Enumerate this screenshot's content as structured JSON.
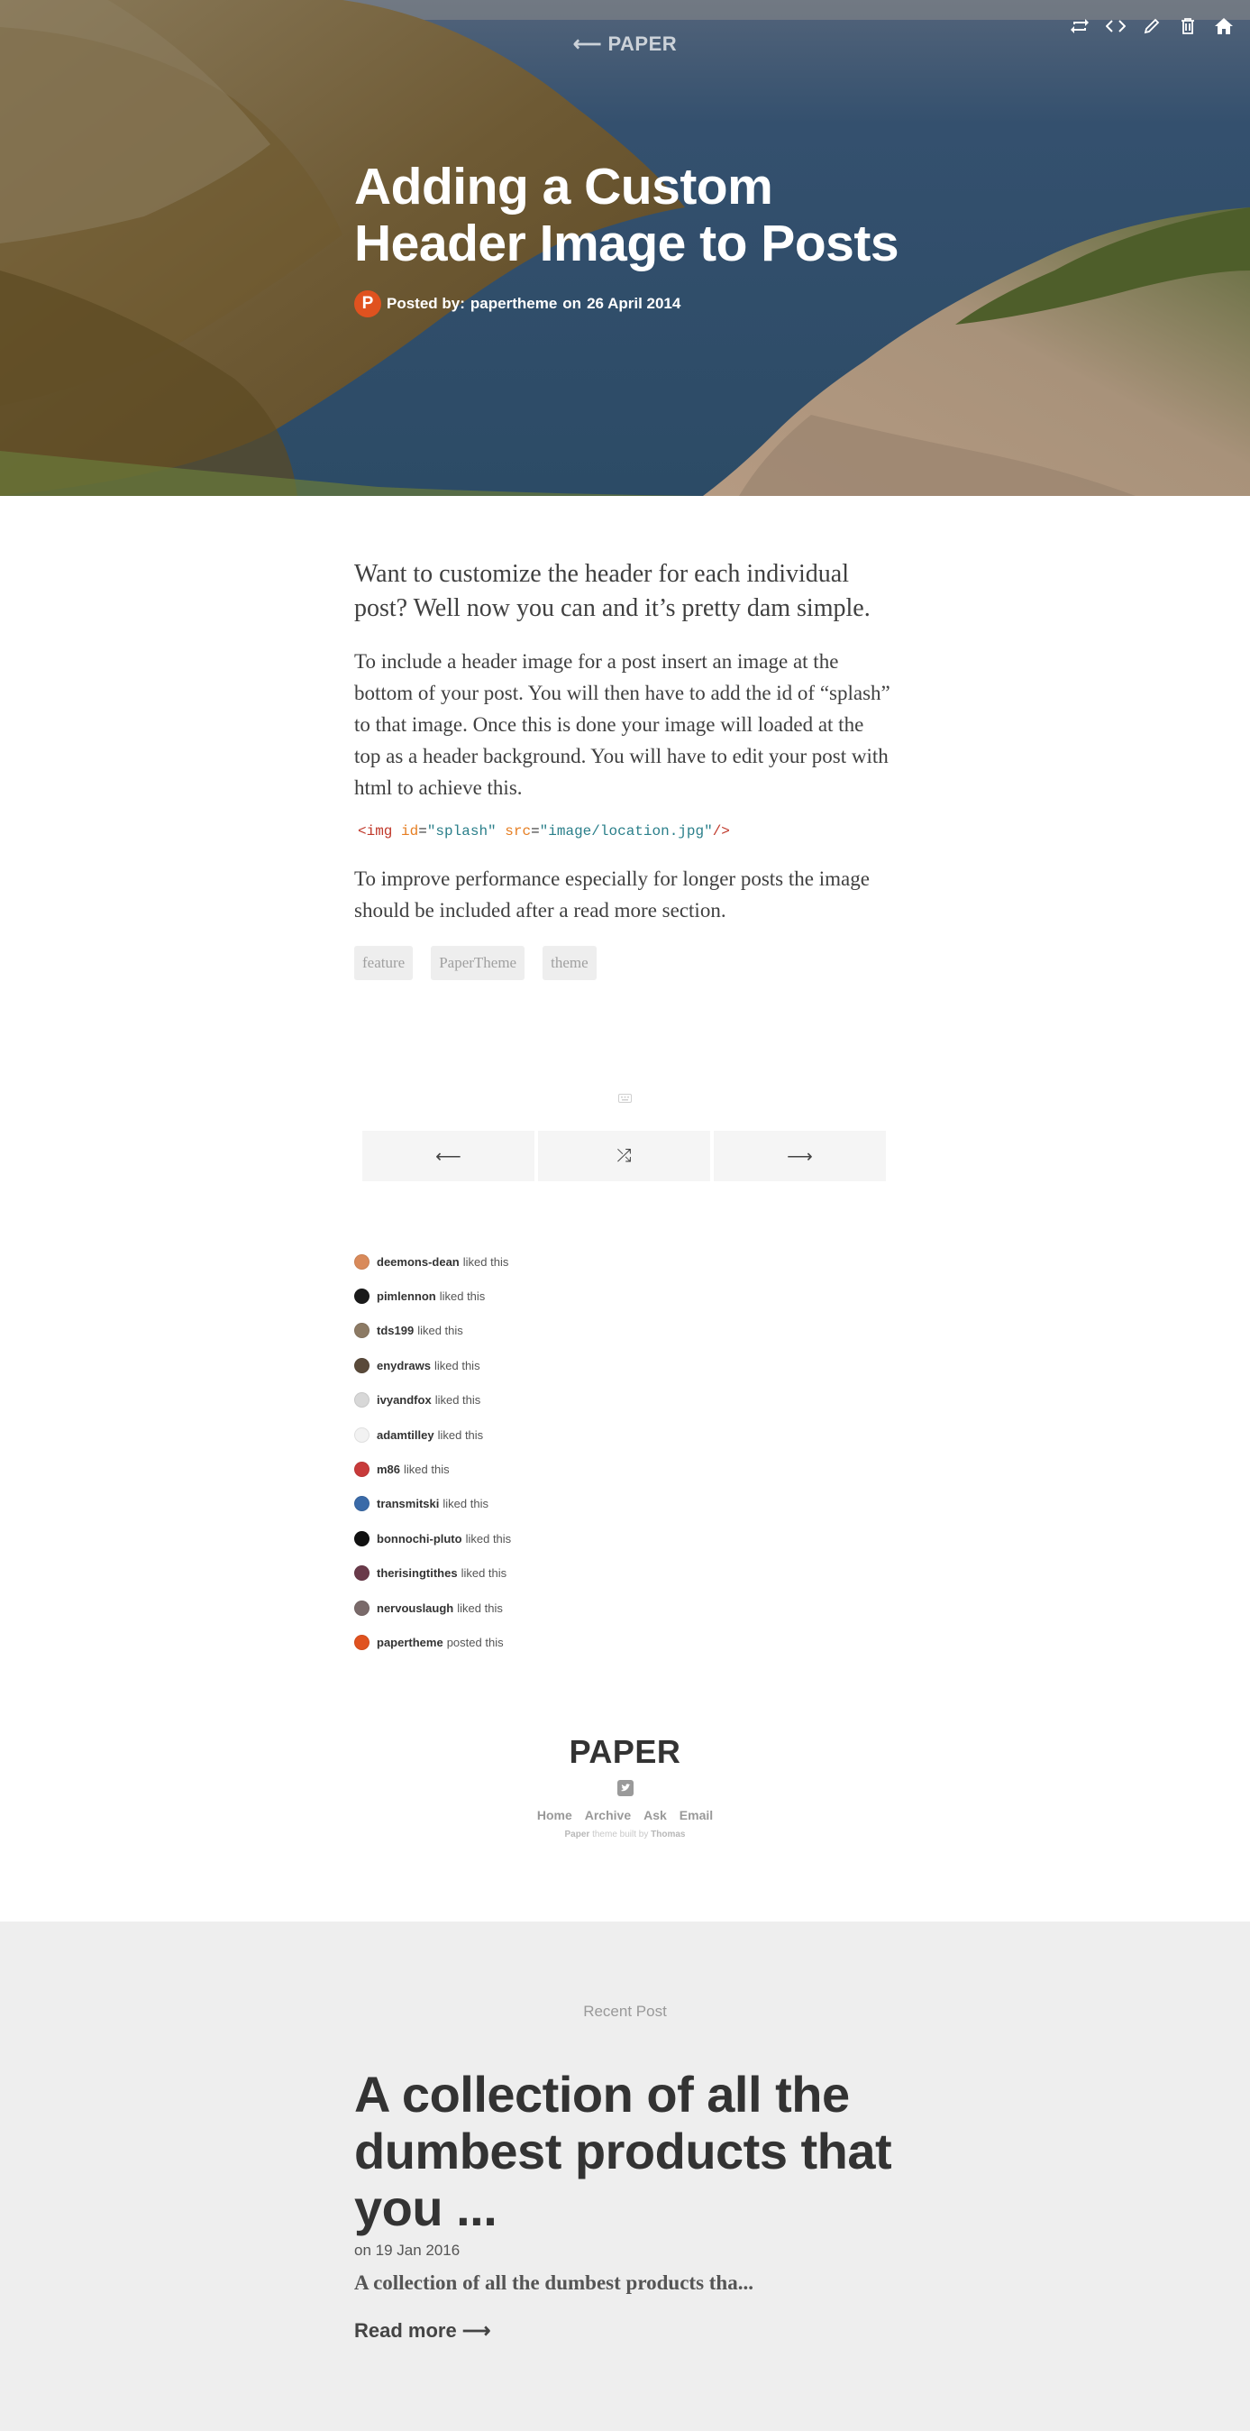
{
  "hero": {
    "back_link": "⟵ PAPER",
    "title_line1": "Adding a Custom",
    "title_line2": "Header Image to Posts",
    "avatar_letter": "P",
    "posted_by_label": "Posted by:",
    "author": "papertheme",
    "date_prefix": "on",
    "date": "26 April 2014"
  },
  "toolbar": {
    "icons": [
      "reblog-icon",
      "embed-icon",
      "edit-icon",
      "delete-icon",
      "home-icon"
    ]
  },
  "post": {
    "lead": "Want to customize the header for each individual post? Well now you can and it’s pretty dam simple.",
    "para1": "To include a header image for a post insert an image at the bottom of your post. You will then have to add the id of “splash” to that image. Once this is done your image will loaded at the top as a header background. You will have to edit your post with html to achieve this.",
    "code": {
      "open": "<img",
      "attr1": "id",
      "val1": "\"splash\"",
      "attr2": "src",
      "val2": "\"image/location.jpg\"",
      "close": "/>"
    },
    "para2": "To improve performance especially for longer posts the image should be included after a read more section.",
    "tags": [
      "feature",
      "PaperTheme",
      "theme"
    ]
  },
  "nav": {
    "prev": "⟵",
    "random": "⤮",
    "next": "⟶"
  },
  "notes": [
    {
      "user": "deemons-dean",
      "action": "liked this",
      "color": "#d98a5a"
    },
    {
      "user": "pimlennon",
      "action": "liked this",
      "color": "#1a1a1a"
    },
    {
      "user": "tds199",
      "action": "liked this",
      "color": "#8c7a64"
    },
    {
      "user": "enydraws",
      "action": "liked this",
      "color": "#5a4a3a"
    },
    {
      "user": "ivyandfox",
      "action": "liked this",
      "color": "#d8d8d8"
    },
    {
      "user": "adamtilley",
      "action": "liked this",
      "color": "#f2f2f2"
    },
    {
      "user": "m86",
      "action": "liked this",
      "color": "#c83a3a"
    },
    {
      "user": "transmitski",
      "action": "liked this",
      "color": "#3a6aa8"
    },
    {
      "user": "bonnochi-pluto",
      "action": "liked this",
      "color": "#111111"
    },
    {
      "user": "therisingtithes",
      "action": "liked this",
      "color": "#6a3a4a"
    },
    {
      "user": "nervouslaugh",
      "action": "liked this",
      "color": "#7a6a6a"
    },
    {
      "user": "papertheme",
      "action": "posted this",
      "color": "#e0521f"
    }
  ],
  "footer": {
    "logo": "PAPER",
    "links": [
      "Home",
      "Archive",
      "Ask",
      "Email"
    ],
    "credit_name": "Paper",
    "credit_middle": "theme built by",
    "credit_author": "Thomas"
  },
  "recent": {
    "label": "Recent Post",
    "title_line1": "A collection of all the",
    "title_line2": "dumbest products that",
    "title_line3": "you ...",
    "meta": "on 19 Jan 2016",
    "excerpt": "A collection of all the dumbest products tha...",
    "read_more": "Read more ⟶"
  }
}
